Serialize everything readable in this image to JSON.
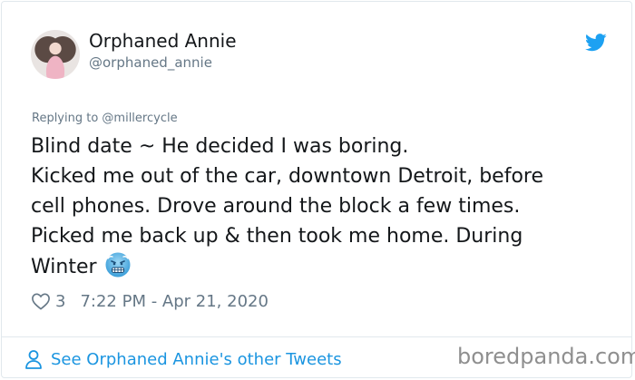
{
  "tweet": {
    "author_name": "Orphaned Annie",
    "author_handle": "@orphaned_annie",
    "replying_to": "Replying to @millercycle",
    "body_lines": [
      "Blind date ~ He decided I was boring.",
      "Kicked me out of the car, downtown Detroit, before",
      "cell phones. Drove around the block a few times.",
      "Picked me back up & then took me home. During",
      "Winter"
    ],
    "emoji": "cold-face-emoji",
    "likes": "3",
    "timestamp": "7:22 PM - Apr 21, 2020",
    "see_more": "See Orphaned Annie's other Tweets"
  },
  "watermark": "boredpanda.com",
  "colors": {
    "link": "#1b95e0",
    "twitter_blue": "#1da1f2",
    "muted": "#657786",
    "text": "#14171a"
  }
}
